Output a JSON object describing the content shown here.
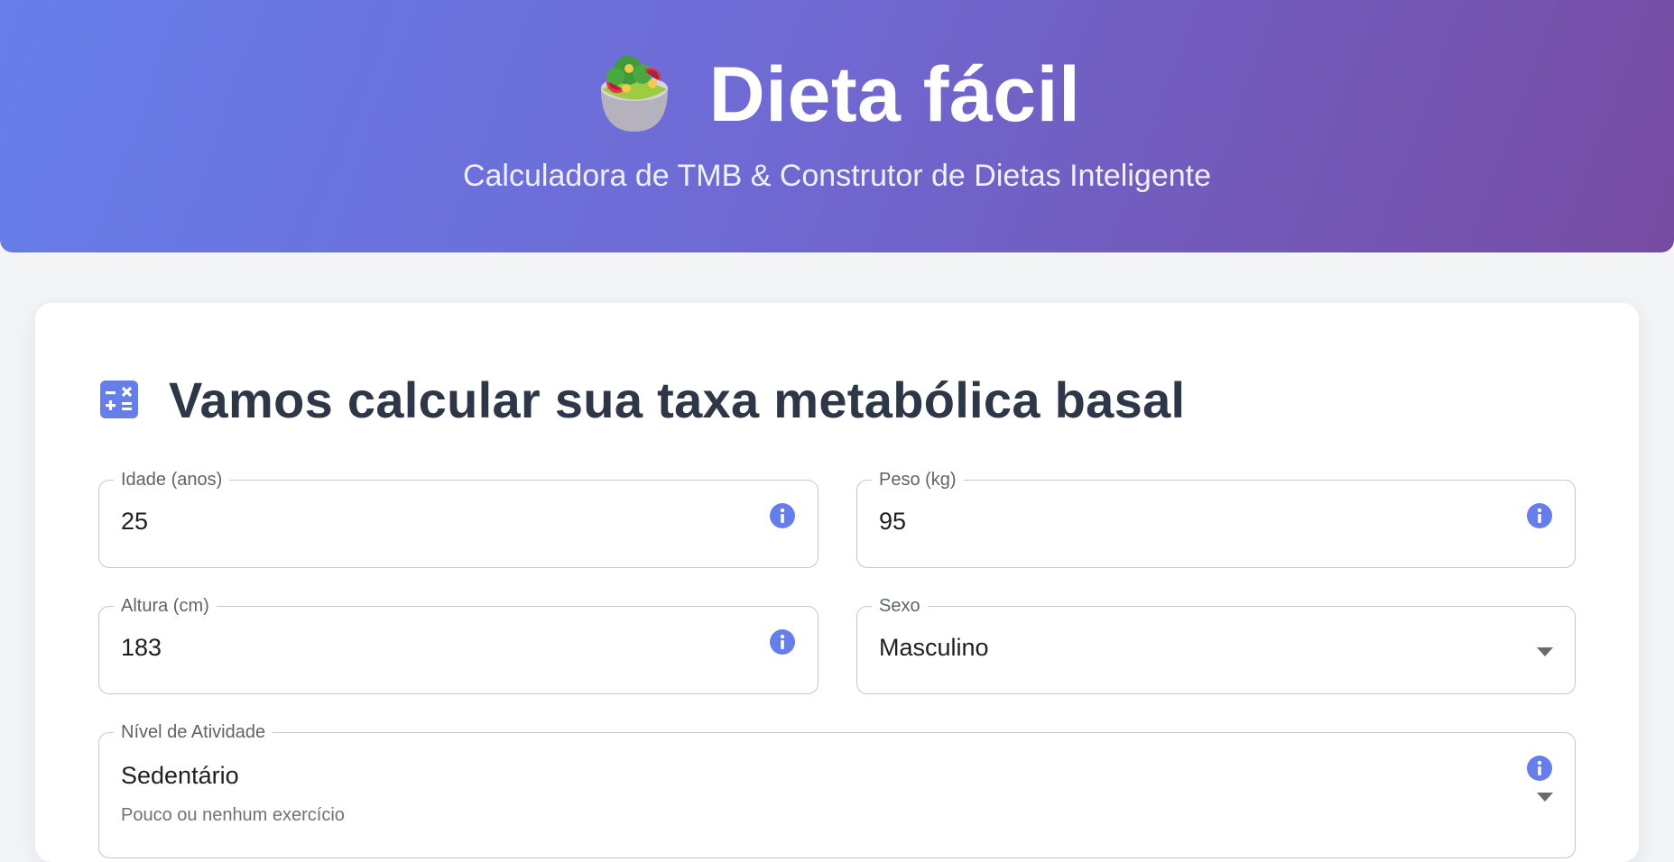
{
  "header": {
    "logo_icon": "salad-bowl-icon",
    "title": "Dieta fácil",
    "subtitle": "Calculadora de TMB & Construtor de Dietas Inteligente",
    "gradient_start": "#667eea",
    "gradient_end": "#764ba2"
  },
  "form": {
    "section_icon": "calculator-icon",
    "title": "Vamos calcular sua taxa metabólica basal",
    "fields": {
      "age": {
        "label": "Idade (anos)",
        "value": "25",
        "icon": "info-icon"
      },
      "weight": {
        "label": "Peso (kg)",
        "value": "95",
        "icon": "info-icon"
      },
      "height": {
        "label": "Altura (cm)",
        "value": "183",
        "icon": "info-icon"
      },
      "sex": {
        "label": "Sexo",
        "value": "Masculino",
        "icon": "chevron-down-icon"
      },
      "activity": {
        "label": "Nível de Atividade",
        "value": "Sedentário",
        "helper": "Pouco ou nenhum exercício",
        "icons": [
          "info-icon",
          "chevron-down-icon"
        ]
      }
    }
  },
  "colors": {
    "accent": "#667eea",
    "title_text": "#2d3748",
    "page_background": "#f3f4f6"
  }
}
